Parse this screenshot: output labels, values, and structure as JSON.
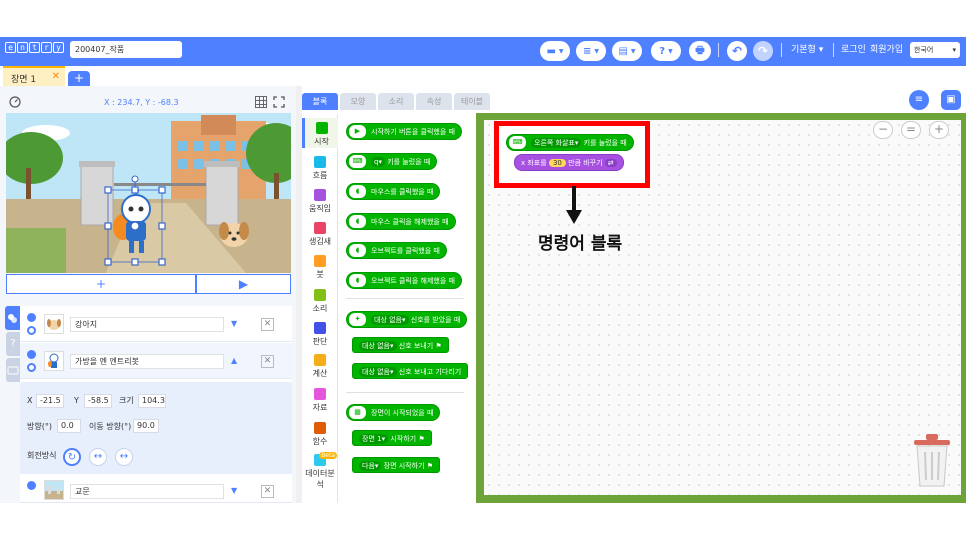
{
  "app": {
    "logo_letters": [
      "e",
      "n",
      "t",
      "r",
      "y"
    ],
    "project_name": "200407_작품",
    "accent_color": "#4f80ff",
    "block_color": "#00b400"
  },
  "header": {
    "mode_label": "기본형",
    "login_label": "로그인",
    "signup_label": "회원가입",
    "language": "한국어",
    "help_label": "?"
  },
  "tabs": {
    "scene_tab": "장면 1",
    "add_tab": "+"
  },
  "stage": {
    "coords": "X : 234.7, Y : -68.3",
    "add_button": "+",
    "play_button": "▶"
  },
  "objects": [
    {
      "name": "강아지",
      "arrow": "▼"
    },
    {
      "name": "가방을 멘 엔트리봇",
      "arrow": "▲"
    },
    {
      "name": "교문",
      "arrow": "▼"
    }
  ],
  "properties": {
    "x_label": "X",
    "x_value": "-21.5",
    "y_label": "Y",
    "y_value": "-58.5",
    "size_label": "크기",
    "size_value": "104.3",
    "dir_label": "방향(°)",
    "dir_value": "0.0",
    "move_dir_label": "이동 방향(°)",
    "move_dir_value": "90.0",
    "rotation_label": "회전방식"
  },
  "palette_tabs": [
    "블록",
    "모양",
    "소리",
    "속성",
    "테이블"
  ],
  "categories": [
    {
      "label": "시작",
      "color": "#00b400"
    },
    {
      "label": "흐름",
      "color": "#19baea"
    },
    {
      "label": "움직임",
      "color": "#a751e3"
    },
    {
      "label": "생김새",
      "color": "#ec4466"
    },
    {
      "label": "붓",
      "color": "#ff9e20"
    },
    {
      "label": "소리",
      "color": "#83c017"
    },
    {
      "label": "판단",
      "color": "#4252e9"
    },
    {
      "label": "계산",
      "color": "#f4af18"
    },
    {
      "label": "자료",
      "color": "#e457dc"
    },
    {
      "label": "함수",
      "color": "#de5c04"
    },
    {
      "label": "데이터분석",
      "color": "#2fc9f0"
    }
  ],
  "beta_label": "Beta",
  "palette_blocks": {
    "b1": "시작하기 버튼을 클릭했을 때",
    "b2_key": "q",
    "b2": "키를 눌렀을 때",
    "b3": "마우스를 클릭했을 때",
    "b4": "마우스 클릭을 해제했을 때",
    "b5": "오브젝트를 클릭했을 때",
    "b6": "오브젝트 클릭을 해제했을 때",
    "b7_target": "대상 없음",
    "b7": "신호를 받았을 때",
    "b8_target": "대상 없음",
    "b8": "신호 보내기",
    "b9_target": "대상 없음",
    "b9": "신호 보내고 기다리기",
    "b10": "장면이 시작되었을 때",
    "b11_target": "장면 1",
    "b11": "시작하기",
    "b12_target": "다음",
    "b12": "장면 시작하기"
  },
  "workspace": {
    "zoom_out": "−",
    "zoom_reset": "=",
    "zoom_in": "+",
    "hat_key": "오른쪽 화살표",
    "hat_text": "키를 눌렀을 때",
    "move_prefix": "x 좌표를",
    "move_value": "30",
    "move_suffix": "만큼 바꾸기",
    "annotation": "명령어 블록"
  }
}
